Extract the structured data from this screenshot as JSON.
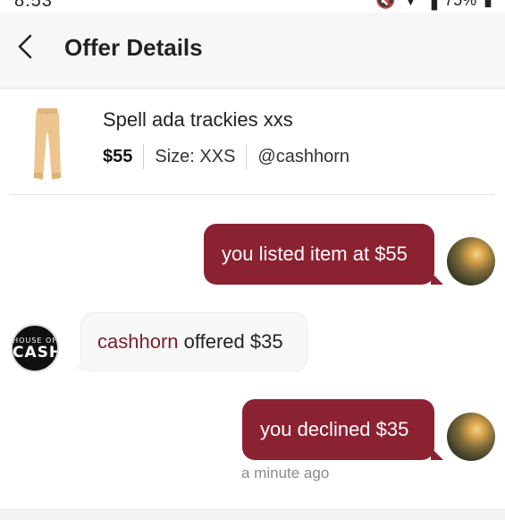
{
  "status_bar": {
    "time": "8:53",
    "battery": "75%"
  },
  "header": {
    "title": "Offer Details",
    "back_icon": "chevron-left-icon"
  },
  "item": {
    "title": "Spell ada trackies xxs",
    "price": "$55",
    "size": "Size: XXS",
    "seller": "@cashhorn",
    "image_icon": "trackpants-image"
  },
  "messages": [
    {
      "side": "outgoing",
      "text": "you listed item at $55",
      "avatar": "user-avatar"
    },
    {
      "side": "incoming",
      "user": "cashhorn",
      "text": "offered $35",
      "avatar": "house-of-cash-avatar"
    },
    {
      "side": "outgoing",
      "text": "you declined $35",
      "avatar": "user-avatar"
    }
  ],
  "seller_avatar_text": {
    "line1": "HOUSE OF",
    "line2": "CASH"
  },
  "timestamp": "a minute ago",
  "colors": {
    "accent": "#8b2232",
    "username": "#7a1f2c",
    "header_bg": "#f7f7f7"
  }
}
